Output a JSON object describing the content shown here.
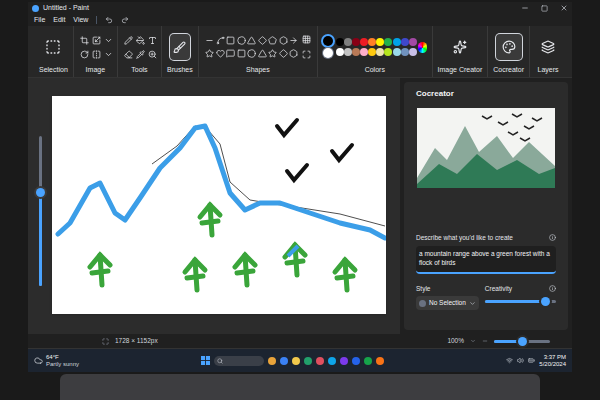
{
  "window": {
    "title": "Untitled - Paint"
  },
  "menu": [
    "File",
    "Edit",
    "View"
  ],
  "ribbon": [
    {
      "label": "Selection",
      "kind": "selection",
      "selected": false
    },
    {
      "label": "Image",
      "kind": "image",
      "selected": false
    },
    {
      "label": "Tools",
      "kind": "tools",
      "selected": false
    },
    {
      "label": "Brushes",
      "kind": "brushes",
      "selected": true
    },
    {
      "label": "Shapes",
      "kind": "shapes",
      "selected": false
    },
    {
      "label": "Colors",
      "kind": "colors",
      "selected": false
    },
    {
      "label": "Image Creator",
      "kind": "creator",
      "selected": false
    },
    {
      "label": "Cocreator",
      "kind": "cocreator",
      "selected": true
    },
    {
      "label": "Layers",
      "kind": "layers",
      "selected": false
    }
  ],
  "current_colors": [
    {
      "color": "#000000",
      "selected": true
    },
    {
      "color": "#ffffff",
      "selected": false
    }
  ],
  "palette": [
    {
      "color": "#000000"
    },
    {
      "color": "#7f7f7f"
    },
    {
      "color": "#880015"
    },
    {
      "color": "#ed1c24"
    },
    {
      "color": "#ff7f27"
    },
    {
      "color": "#fff200"
    },
    {
      "color": "#22b14c"
    },
    {
      "color": "#00a2e8"
    },
    {
      "color": "#3f48cc"
    },
    {
      "color": "#a349a4"
    },
    {
      "color": "#ffffff"
    },
    {
      "color": "#c3c3c3"
    },
    {
      "color": "#b97a57"
    },
    {
      "color": "#ffaec9"
    },
    {
      "color": "#ffc90e"
    },
    {
      "color": "#efe4b0"
    },
    {
      "color": "#b5e61d"
    },
    {
      "color": "#99d9ea"
    },
    {
      "color": "#7092be"
    },
    {
      "color": "#c8bfe7"
    }
  ],
  "brush_size": {
    "level": 0.62
  },
  "cocreator": {
    "title": "Cocreator",
    "prompt_label": "Describe what you'd like to create",
    "prompt": "a mountain range above a green forest with a flock of birds",
    "style_label": "Style",
    "style": "No Selection",
    "creativity_label": "Creativity",
    "creativity_level": 0.85
  },
  "status_bar": {
    "canvas_size": "1728 × 1152px",
    "zoom": "100%",
    "zoom_level": 0.5
  },
  "taskbar": {
    "temperature": "64°F",
    "weather": "Partly sunny",
    "time": "3:37 PM",
    "date": "5/20/2024"
  }
}
